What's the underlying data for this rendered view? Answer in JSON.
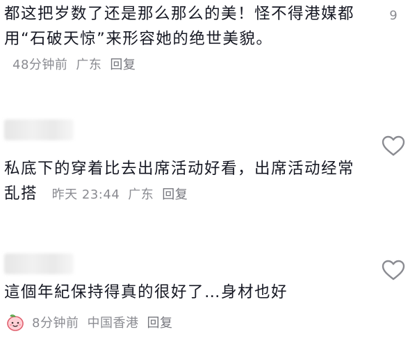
{
  "comments": [
    {
      "text": "都这把岁数了还是那么那么的美！怪不得港媒都用“石破天惊”来形容她的绝世美貌。",
      "time": "48分钟前",
      "location": "广东",
      "reply_label": "回复",
      "like_count": "9"
    },
    {
      "text": "私底下的穿着比去出席活动好看，出席活动经常乱搭",
      "time": "昨天 23:44",
      "location": "广东",
      "reply_label": "回复",
      "like_count": ""
    },
    {
      "text": "這個年紀保持得真的很好了…身材也好",
      "time": "8分钟前",
      "location": "中国香港",
      "reply_label": "回复",
      "like_count": ""
    }
  ],
  "colors": {
    "text": "#161823",
    "meta": "#8a8b91",
    "icon": "#8a8b91"
  },
  "icons": {
    "like": "heart-outline-icon",
    "badge": "peach-emoji-icon"
  }
}
